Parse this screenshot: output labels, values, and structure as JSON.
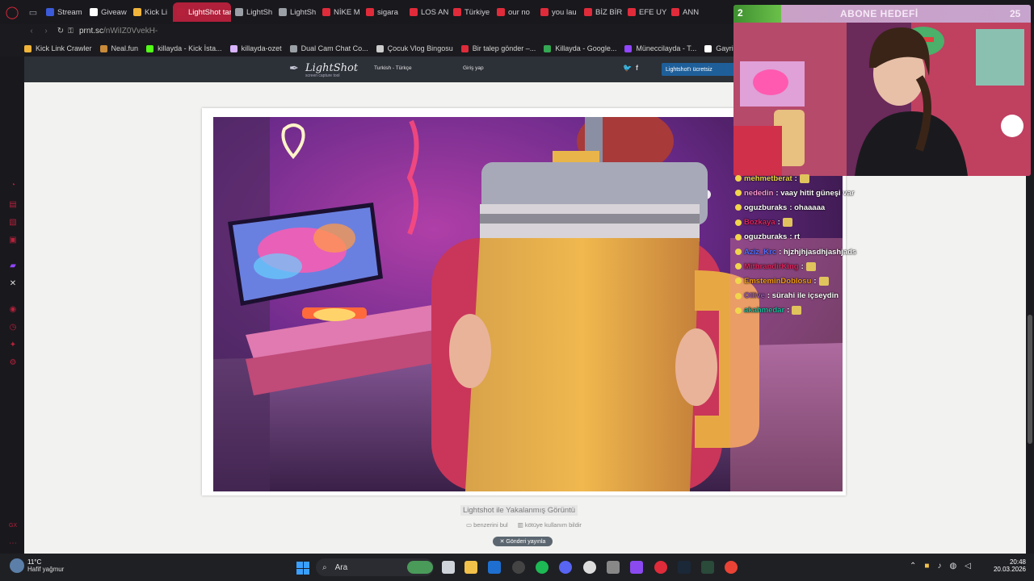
{
  "browser": {
    "tabs": [
      {
        "label": "Stream",
        "color": "#3b5bdb"
      },
      {
        "label": "Giveaw",
        "color": "#ffffff"
      },
      {
        "label": "Kick Li",
        "color": "#f1b43a"
      },
      {
        "label": "LightShot tara",
        "color": "#b5213b",
        "active": true
      },
      {
        "label": "LightSh",
        "color": "#9aa0a6"
      },
      {
        "label": "LightSh",
        "color": "#9aa0a6"
      },
      {
        "label": "NİKE M",
        "color": "#e02b3a"
      },
      {
        "label": "sigara",
        "color": "#e02b3a"
      },
      {
        "label": "LOS AN",
        "color": "#e02b3a"
      },
      {
        "label": "Türkiye",
        "color": "#e02b3a"
      },
      {
        "label": "our no",
        "color": "#e02b3a"
      },
      {
        "label": "you lau",
        "color": "#e02b3a"
      },
      {
        "label": "BİZ BİR",
        "color": "#e02b3a"
      },
      {
        "label": "EFE UY",
        "color": "#e02b3a"
      },
      {
        "label": "ANN",
        "color": "#e02b3a"
      }
    ],
    "url_host": "prnt.sc",
    "url_path": "/nWiIZ0VvekH-",
    "bookmarks": [
      {
        "label": "Kick Link Crawler",
        "color": "#f1b43a"
      },
      {
        "label": "Neal.fun",
        "color": "#c98a3a"
      },
      {
        "label": "killayda - Kick İsta...",
        "color": "#53fc18"
      },
      {
        "label": "killayda-ozet",
        "color": "#d8b4fe"
      },
      {
        "label": "Dual Cam Chat Co...",
        "color": "#9aa0a6"
      },
      {
        "label": "Çocuk Vlog Bingosu",
        "color": "#cccccc"
      },
      {
        "label": "Bir talep gönder –...",
        "color": "#e02b3a"
      },
      {
        "label": "Killayda - Google...",
        "color": "#34a853"
      },
      {
        "label": "Müneccilayda - T...",
        "color": "#9146ff"
      },
      {
        "label": "Gayri",
        "color": "#ffffff"
      }
    ]
  },
  "lightshot": {
    "logo_title": "LightShot",
    "logo_subtitle": "screen capture tool",
    "language": "Turkish - Türkçe",
    "login": "Giriş yap",
    "twitter": "🐦",
    "facebook": "f",
    "download": "Lightshot'ı ücretsiz",
    "caption": "Lightshot ile Yakalanmış Görüntü",
    "find_similar": "benzerini bul",
    "report": "kötüye kullanım bildir",
    "tweet": "Gönderi yayınla"
  },
  "stream": {
    "goal_left": "2",
    "goal_title": "ABONE HEDEFİ",
    "goal_right": "25"
  },
  "chat": [
    {
      "user": "mehmetberat",
      "user_color": "#e9d84a",
      "msg": ":",
      "emote": true
    },
    {
      "user": "nededin",
      "user_color": "#ff9ad5",
      "msg": ": vaay hitit güneşi var",
      "emote": false
    },
    {
      "user": "oguzburaks",
      "user_color": "#ffffff",
      "msg": ": ohaaaaa",
      "emote": false
    },
    {
      "user": "Bozkaya",
      "user_color": "#e0245e",
      "msg": ":",
      "emote": true
    },
    {
      "user": "oguzburaks",
      "user_color": "#ffffff",
      "msg": ": rt",
      "emote": false
    },
    {
      "user": "Aziz_Krc",
      "user_color": "#4f6fff",
      "msg": ": hjzhjhjasdhjashjads",
      "emote": false
    },
    {
      "user": "MithrandirKing",
      "user_color": "#e0245e",
      "msg": ":",
      "emote": true
    },
    {
      "user": "EmsteminDoblosu",
      "user_color": "#f39c12",
      "msg": ":",
      "emote": true
    },
    {
      "user": "Ollive",
      "user_color": "#9b59b6",
      "msg": ": sürahi ile içseydin",
      "emote": false
    },
    {
      "user": "akahmedar",
      "user_color": "#1abc9c",
      "msg": ":",
      "emote": true
    }
  ],
  "taskbar": {
    "weather_temp": "11°C",
    "weather_desc": "Hafif yağmur",
    "search_placeholder": "Ara",
    "time": "20:48",
    "date": "20.03.2026"
  }
}
